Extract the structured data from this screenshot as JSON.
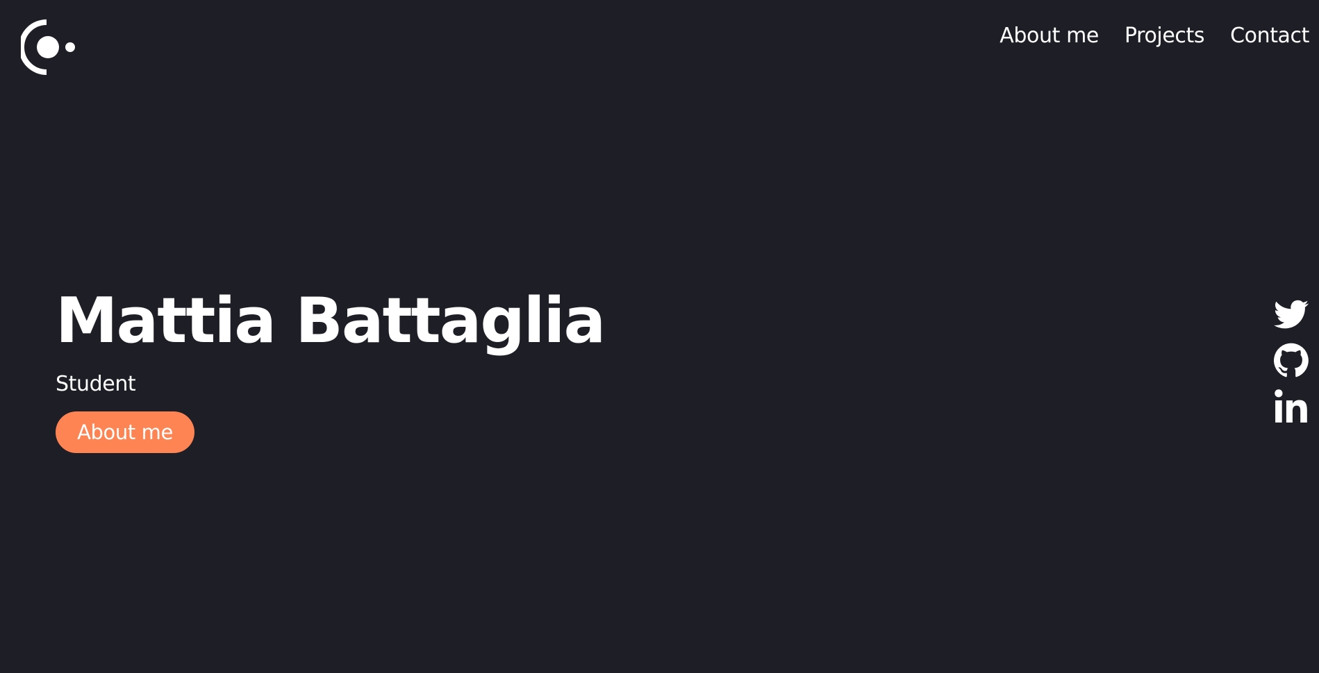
{
  "nav": {
    "items": [
      {
        "label": "About me"
      },
      {
        "label": "Projects"
      },
      {
        "label": "Contact"
      }
    ]
  },
  "hero": {
    "name": "Mattia Battaglia",
    "role": "Student",
    "cta_label": "About me"
  },
  "social": {
    "icons": [
      "twitter-icon",
      "github-icon",
      "linkedin-icon"
    ]
  },
  "colors": {
    "background": "#1e1e27",
    "accent": "#ff8453",
    "text": "#ffffff"
  }
}
